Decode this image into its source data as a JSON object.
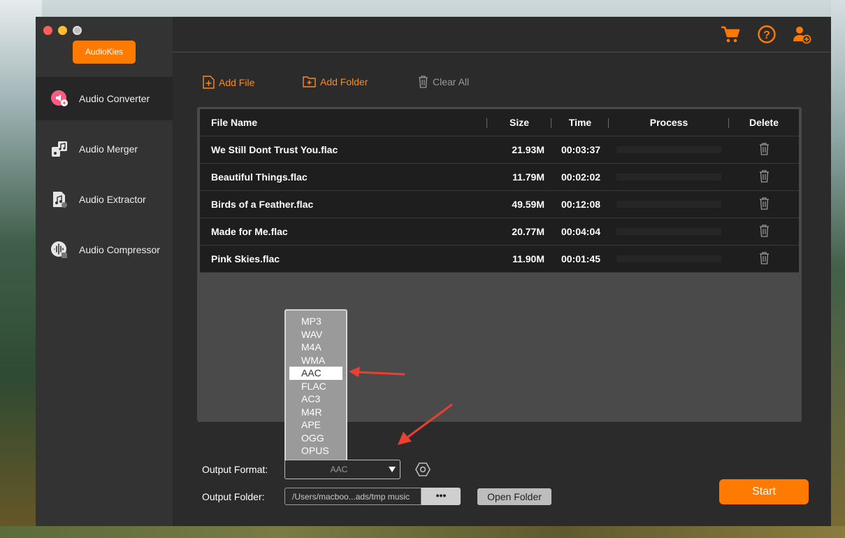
{
  "app": {
    "brand": "AudioKies"
  },
  "sidebar": {
    "items": [
      {
        "label": "Audio Converter",
        "icon": "audio-converter-icon",
        "active": true
      },
      {
        "label": "Audio Merger",
        "icon": "audio-merger-icon",
        "active": false
      },
      {
        "label": "Audio Extractor",
        "icon": "audio-extractor-icon",
        "active": false
      },
      {
        "label": "Audio Compressor",
        "icon": "audio-compressor-icon",
        "active": false
      }
    ]
  },
  "topbar": {
    "icons": [
      "cart-icon",
      "help-icon",
      "user-add-icon"
    ]
  },
  "toolbar": {
    "add_file": "Add File",
    "add_folder": "Add Folder",
    "clear_all": "Clear All"
  },
  "table": {
    "columns": [
      "File Name",
      "Size",
      "Time",
      "Process",
      "Delete"
    ],
    "rows": [
      {
        "name": "We Still Dont Trust You.flac",
        "size": "21.93M",
        "time": "00:03:37"
      },
      {
        "name": "Beautiful Things.flac",
        "size": "11.79M",
        "time": "00:02:02"
      },
      {
        "name": "Birds of a Feather.flac",
        "size": "49.59M",
        "time": "00:12:08"
      },
      {
        "name": "Made for Me.flac",
        "size": "20.77M",
        "time": "00:04:04"
      },
      {
        "name": "Pink Skies.flac",
        "size": "11.90M",
        "time": "00:01:45"
      }
    ]
  },
  "format_dropdown": {
    "options": [
      "MP3",
      "WAV",
      "M4A",
      "WMA",
      "AAC",
      "FLAC",
      "AC3",
      "M4R",
      "APE",
      "OGG",
      "OPUS"
    ],
    "highlighted": "AAC"
  },
  "output": {
    "format_label": "Output Format:",
    "format_value": "AAC",
    "folder_label": "Output Folder:",
    "folder_path": "/Users/macboo...ads/tmp music",
    "browse_label": "•••",
    "open_folder": "Open Folder"
  },
  "start_button": "Start",
  "colors": {
    "accent": "#ff7a00",
    "window_bg": "#2b2b2b",
    "sidebar_bg": "#333333",
    "annotation_arrow": "#e8412f"
  }
}
